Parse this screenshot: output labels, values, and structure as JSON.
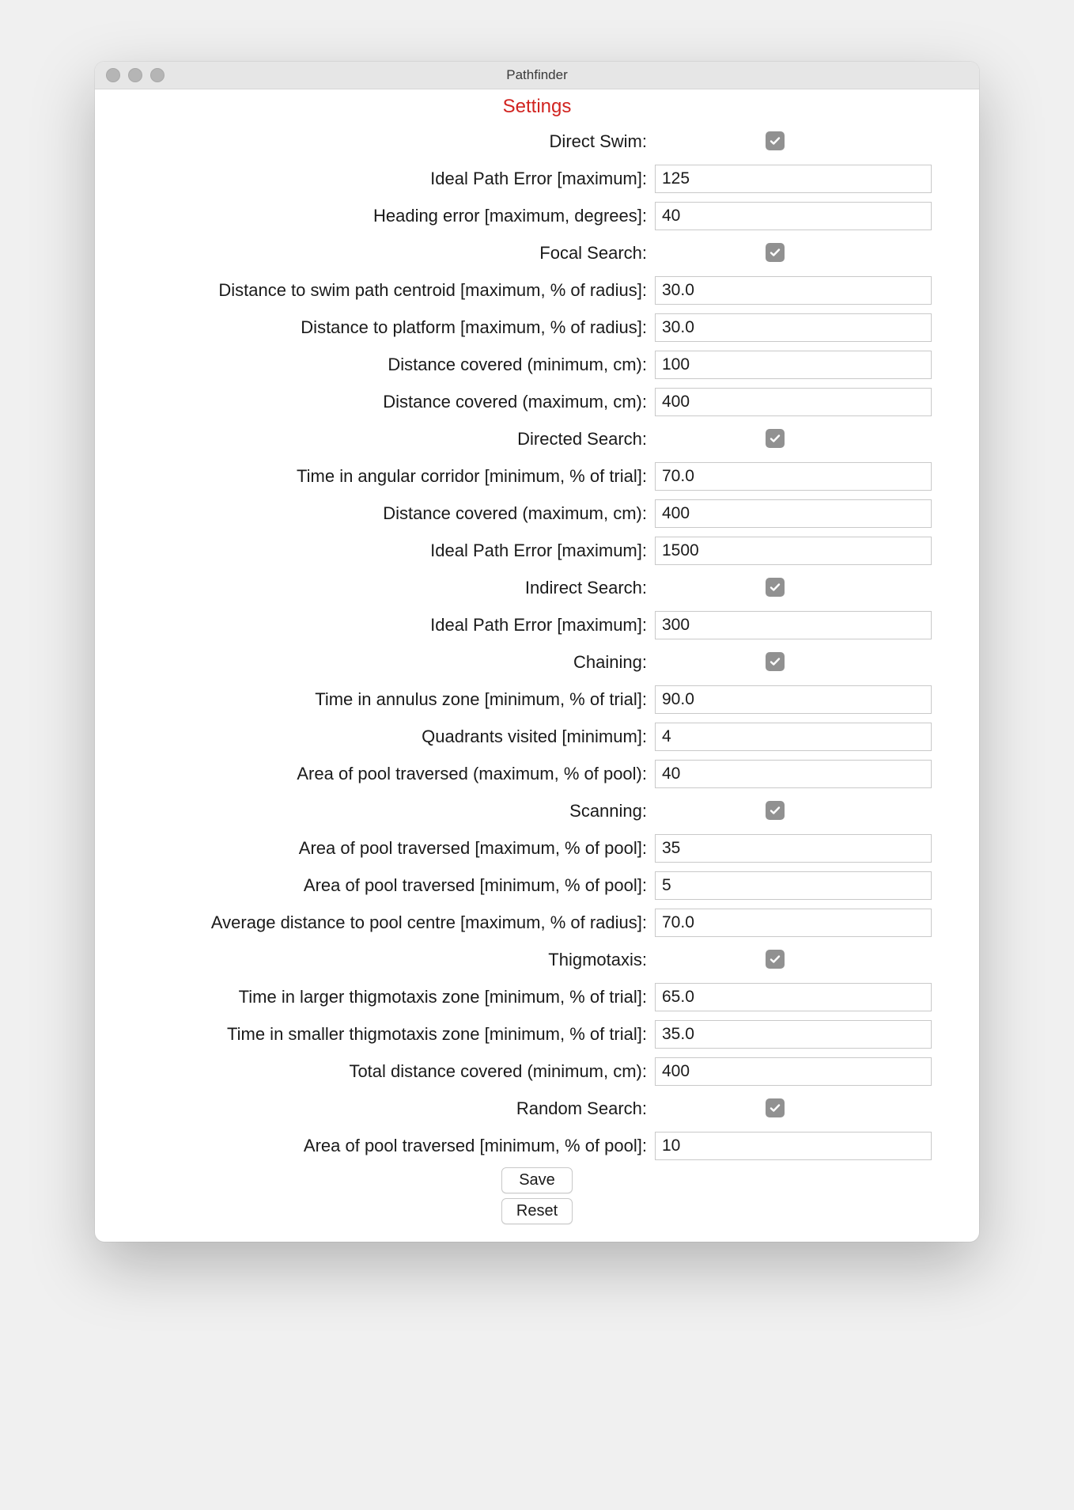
{
  "window_title": "Pathfinder",
  "header": "Settings",
  "sections": {
    "direct_swim": {
      "label": "Direct Swim:",
      "checked": true,
      "fields": {
        "ideal_path_error": {
          "label": "Ideal Path Error [maximum]:",
          "value": "125"
        },
        "heading_error": {
          "label": "Heading error [maximum, degrees]:",
          "value": "40"
        }
      }
    },
    "focal_search": {
      "label": "Focal Search:",
      "checked": true,
      "fields": {
        "dist_centroid": {
          "label": "Distance to swim path centroid [maximum, % of radius]:",
          "value": "30.0"
        },
        "dist_platform": {
          "label": "Distance to platform [maximum, % of radius]:",
          "value": "30.0"
        },
        "dist_cov_min": {
          "label": "Distance covered (minimum, cm):",
          "value": "100"
        },
        "dist_cov_max": {
          "label": "Distance covered (maximum, cm):",
          "value": "400"
        }
      }
    },
    "directed_search": {
      "label": "Directed Search:",
      "checked": true,
      "fields": {
        "angular_corridor": {
          "label": "Time in angular corridor [minimum, % of trial]:",
          "value": "70.0"
        },
        "dist_cov_max": {
          "label": "Distance covered (maximum, cm):",
          "value": "400"
        },
        "ideal_path_error": {
          "label": "Ideal Path Error [maximum]:",
          "value": "1500"
        }
      }
    },
    "indirect_search": {
      "label": "Indirect Search:",
      "checked": true,
      "fields": {
        "ideal_path_error": {
          "label": "Ideal Path Error [maximum]:",
          "value": "300"
        }
      }
    },
    "chaining": {
      "label": "Chaining:",
      "checked": true,
      "fields": {
        "annulus_time": {
          "label": "Time in annulus zone [minimum, % of trial]:",
          "value": "90.0"
        },
        "quadrants": {
          "label": "Quadrants visited [minimum]:",
          "value": "4"
        },
        "area_max": {
          "label": "Area of pool traversed (maximum, % of pool):",
          "value": "40"
        }
      }
    },
    "scanning": {
      "label": "Scanning:",
      "checked": true,
      "fields": {
        "area_max": {
          "label": "Area of pool traversed [maximum, % of pool]:",
          "value": "35"
        },
        "area_min": {
          "label": "Area of pool traversed [minimum, % of pool]:",
          "value": "5"
        },
        "avg_dist": {
          "label": "Average distance to pool centre [maximum, % of radius]:",
          "value": "70.0"
        }
      }
    },
    "thigmotaxis": {
      "label": "Thigmotaxis:",
      "checked": true,
      "fields": {
        "larger_zone": {
          "label": "Time in larger thigmotaxis zone [minimum, % of trial]:",
          "value": "65.0"
        },
        "smaller_zone": {
          "label": "Time in smaller thigmotaxis zone [minimum, % of trial]:",
          "value": "35.0"
        },
        "total_dist": {
          "label": "Total distance covered (minimum, cm):",
          "value": "400"
        }
      }
    },
    "random_search": {
      "label": "Random Search:",
      "checked": true,
      "fields": {
        "area_min": {
          "label": "Area of pool traversed [minimum, % of pool]:",
          "value": "10"
        }
      }
    }
  },
  "buttons": {
    "save": "Save",
    "reset": "Reset"
  }
}
